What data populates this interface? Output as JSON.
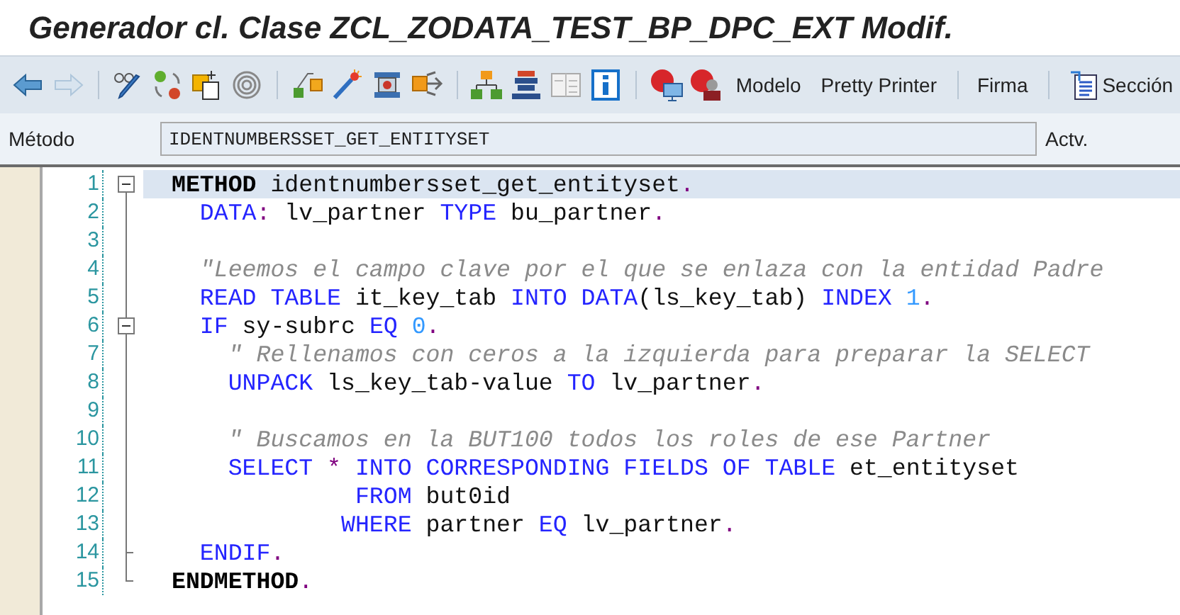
{
  "window": {
    "title": "Generador cl. Clase ZCL_ZODATA_TEST_BP_DPC_EXT Modif."
  },
  "toolbar": {
    "items": [
      {
        "kind": "back",
        "disabled": false
      },
      {
        "kind": "forward",
        "disabled": true
      },
      {
        "kind": "separator"
      },
      {
        "kind": "glasses-pencil",
        "disabled": false
      },
      {
        "kind": "circles",
        "disabled": false
      },
      {
        "kind": "copy",
        "disabled": false
      },
      {
        "kind": "spiral",
        "disabled": false
      },
      {
        "kind": "separator"
      },
      {
        "kind": "nodes",
        "disabled": false
      },
      {
        "kind": "wand",
        "disabled": false
      },
      {
        "kind": "clamp",
        "disabled": false
      },
      {
        "kind": "move-out",
        "disabled": false
      },
      {
        "kind": "separator"
      },
      {
        "kind": "hierarchy",
        "disabled": false
      },
      {
        "kind": "stack",
        "disabled": false
      },
      {
        "kind": "window",
        "disabled": false
      },
      {
        "kind": "info",
        "disabled": false
      },
      {
        "kind": "separator"
      },
      {
        "kind": "stop-screen",
        "disabled": false
      },
      {
        "kind": "stop-person",
        "disabled": false
      },
      {
        "kind": "text",
        "label": "Modelo",
        "disabled": false
      },
      {
        "kind": "text",
        "label": "Pretty Printer",
        "disabled": false
      },
      {
        "kind": "separator"
      },
      {
        "kind": "text",
        "label": "Firma",
        "disabled": false
      },
      {
        "kind": "separator"
      },
      {
        "kind": "doc-text",
        "label": "Sección",
        "disabled": false
      }
    ]
  },
  "method_row": {
    "label": "Método",
    "value": "IDENTNUMBERSSET_GET_ENTITYSET",
    "status": "Actv."
  },
  "editor": {
    "lines": [
      {
        "number": "1",
        "kind": "start-top",
        "selected": true,
        "tokens": [
          {
            "kind": "kwb",
            "t": "METHOD"
          },
          {
            "kind": "id",
            "t": " identnumbersset_get_entityset"
          },
          {
            "kind": "op",
            "t": "."
          }
        ]
      },
      {
        "number": "2",
        "kind": "mid",
        "selected": false,
        "tokens": [
          {
            "kind": "kw",
            "t": "  DATA"
          },
          {
            "kind": "op",
            "t": ":"
          },
          {
            "kind": "id",
            "t": " lv_partner "
          },
          {
            "kind": "kw",
            "t": "TYPE"
          },
          {
            "kind": "id",
            "t": " bu_partner"
          },
          {
            "kind": "op",
            "t": "."
          }
        ]
      },
      {
        "number": "3",
        "kind": "mid",
        "selected": false
      },
      {
        "number": "4",
        "kind": "mid",
        "selected": false,
        "tokens": [
          {
            "kind": "cm",
            "t": "  \"Leemos el campo clave por el que se enlaza con la entidad Padre"
          }
        ]
      },
      {
        "number": "5",
        "kind": "mid",
        "selected": false,
        "tokens": [
          {
            "kind": "kw",
            "t": "  READ TABLE"
          },
          {
            "kind": "id",
            "t": " it_key_tab "
          },
          {
            "kind": "kw",
            "t": "INTO DATA"
          },
          {
            "kind": "id",
            "t": "(ls_key_tab) "
          },
          {
            "kind": "kw",
            "t": "INDEX "
          },
          {
            "kind": "num",
            "t": "1"
          },
          {
            "kind": "op",
            "t": "."
          }
        ]
      },
      {
        "number": "6",
        "kind": "start",
        "selected": false,
        "tokens": [
          {
            "kind": "kw",
            "t": "  IF"
          },
          {
            "kind": "id",
            "t": " sy-subrc "
          },
          {
            "kind": "kw",
            "t": "EQ "
          },
          {
            "kind": "num",
            "t": "0"
          },
          {
            "kind": "op",
            "t": "."
          }
        ]
      },
      {
        "number": "7",
        "kind": "mid",
        "selected": false,
        "tokens": [
          {
            "kind": "cm",
            "t": "    \" Rellenamos con ceros a la izquierda para preparar la SELECT"
          }
        ]
      },
      {
        "number": "8",
        "kind": "mid",
        "selected": false,
        "tokens": [
          {
            "kind": "kw",
            "t": "    UNPACK"
          },
          {
            "kind": "id",
            "t": " ls_key_tab-value "
          },
          {
            "kind": "kw",
            "t": "TO"
          },
          {
            "kind": "id",
            "t": " lv_partner"
          },
          {
            "kind": "op",
            "t": "."
          }
        ]
      },
      {
        "number": "9",
        "kind": "mid",
        "selected": false
      },
      {
        "number": "10",
        "kind": "mid",
        "selected": false,
        "tokens": [
          {
            "kind": "cm",
            "t": "    \" Buscamos en la BUT100 todos los roles de ese Partner"
          }
        ]
      },
      {
        "number": "11",
        "kind": "mid",
        "selected": false,
        "tokens": [
          {
            "kind": "kw",
            "t": "    SELECT "
          },
          {
            "kind": "op",
            "t": "*"
          },
          {
            "kind": "kw",
            "t": " INTO CORRESPONDING FIELDS OF TABLE"
          },
          {
            "kind": "id",
            "t": " et_entityset"
          }
        ]
      },
      {
        "number": "12",
        "kind": "mid",
        "selected": false,
        "tokens": [
          {
            "kind": "kw",
            "t": "             FROM"
          },
          {
            "kind": "id",
            "t": " but0id"
          }
        ]
      },
      {
        "number": "13",
        "kind": "mid",
        "selected": false,
        "tokens": [
          {
            "kind": "kw",
            "t": "            WHERE"
          },
          {
            "kind": "id",
            "t": " partner "
          },
          {
            "kind": "kw",
            "t": "EQ"
          },
          {
            "kind": "id",
            "t": " lv_partner"
          },
          {
            "kind": "op",
            "t": "."
          }
        ]
      },
      {
        "number": "14",
        "kind": "end",
        "selected": false,
        "tokens": [
          {
            "kind": "kw",
            "t": "  ENDIF"
          },
          {
            "kind": "op",
            "t": "."
          }
        ]
      },
      {
        "number": "15",
        "kind": "last",
        "selected": false,
        "tokens": [
          {
            "kind": "kwb",
            "t": "ENDMETHOD"
          },
          {
            "kind": "op",
            "t": "."
          }
        ]
      }
    ]
  }
}
